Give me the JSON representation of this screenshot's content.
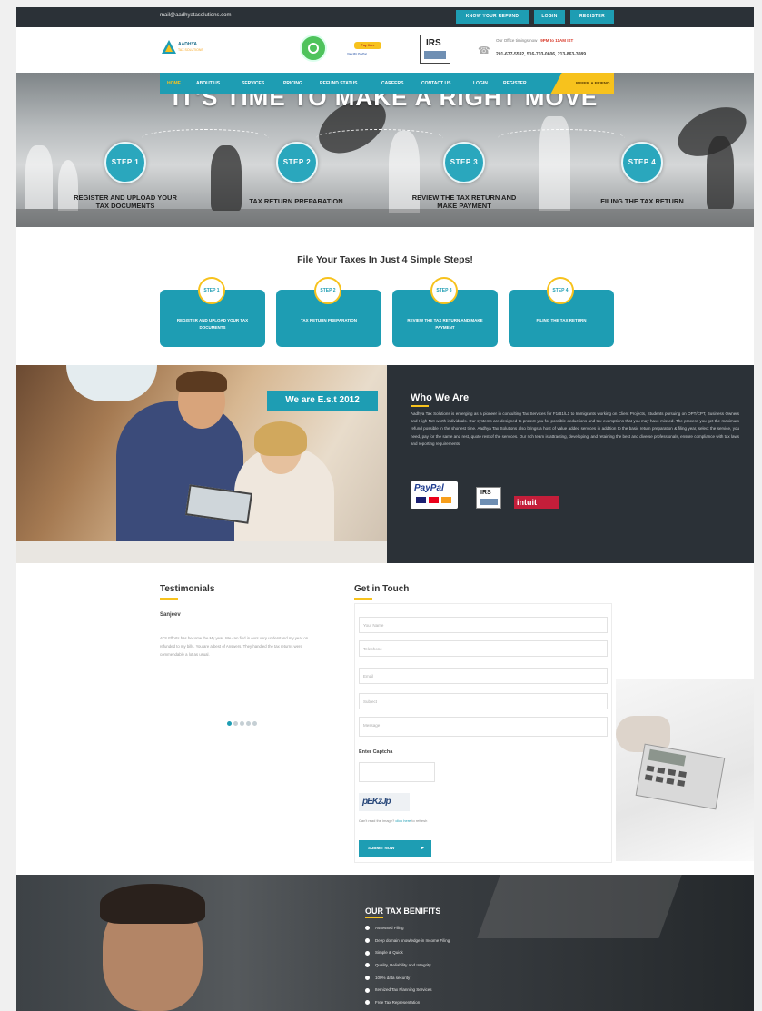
{
  "topbar": {
    "email": "mail@aadhyatasolutions.com",
    "buttons": [
      "KNOW YOUR REFUND",
      "LOGIN",
      "REGISTER"
    ]
  },
  "header": {
    "logo_text": "AADHYA",
    "logo_sub": "TAX SOLUTIONS",
    "pay_text": "Pay Here",
    "pay_sub": "Visa MC PayPal",
    "irs_text": "IRS",
    "office_label": "Our Office timings now :",
    "office_hours": "9PM to 11AM IST",
    "phones": "201-677-5592, 516-703-0606, 213-863-3089"
  },
  "nav": {
    "items": [
      "HOME",
      "ABOUT US",
      "SERVICES",
      "PRICING",
      "REFUND STATUS",
      "CAREERS",
      "CONTACT US",
      "LOGIN",
      "REGISTER"
    ],
    "active": "HOME",
    "cta": "REFER A FRIEND"
  },
  "hero": {
    "headline": "IT'S TIME TO MAKE A RIGHT MOVE",
    "steps": [
      {
        "badge": "STEP 1",
        "caption": "REGISTER AND UPLOAD YOUR TAX DOCUMENTS"
      },
      {
        "badge": "STEP 2",
        "caption": "TAX RETURN PREPARATION"
      },
      {
        "badge": "STEP 3",
        "caption": "REVIEW THE TAX RETURN AND MAKE PAYMENT"
      },
      {
        "badge": "STEP 4",
        "caption": "FILING THE TAX RETURN"
      }
    ]
  },
  "steps_section": {
    "title": "File Your Taxes In Just 4 Simple Steps!",
    "steps": [
      {
        "badge": "STEP 1",
        "label": "REGISTER AND UPLOAD YOUR TAX DOCUMENTS"
      },
      {
        "badge": "STEP 2",
        "label": "TAX RETURN PREPARATION"
      },
      {
        "badge": "STEP 3",
        "label": "REVIEW THE TAX RETURN AND MAKE PAYMENT"
      },
      {
        "badge": "STEP 4",
        "label": "FILING THE TAX RETURN"
      }
    ]
  },
  "who": {
    "badge": "We are E.s.t 2012",
    "title": "Who We Are",
    "text": "Aadhya Tax Solutions is emerging as a pioneer in consulting Tax Services for F1/B1/L1 to Immigrants working on Client Projects, Students pursuing on OPT/CPT, Business Owners and High Net worth individuals. Our systems are designed to protect you for possible deductions and tax exemptions that you may have missed. The process you get the maximum refund possible in the shortest time. Aadhya Tax Solutions also brings a host of value added services in addition to the basic return preparation & filing year, select the service, you need, pay for the same and rest, quote rest of the services. Our rich team is attracting, developing, and retaining the best and diverse professionals, ensure compliance with tax laws and reporting requirements.",
    "logos": {
      "paypal": "PayPal",
      "irs": "IRS",
      "intuit": "intuit"
    }
  },
  "testimonials": {
    "title": "Testimonials",
    "name": "Sanjeev",
    "quote": "ATS Efforts has become the My year. We can find in ours very understand my year on refunded to my bills. You are a best of Answers. They handled the tax returns were commendable a lot as usual."
  },
  "contact": {
    "title": "Get in Touch",
    "placeholders": [
      "Your Name",
      "Telephone",
      "Email",
      "Subject",
      "Message"
    ],
    "captcha_label": "Enter Captcha",
    "captcha_text": "pEKzJp",
    "captcha_help_prefix": "Can't read the image?",
    "captcha_help_link": "click here",
    "captcha_help_suffix": "to refresh",
    "submit": "SUBMIT NOW"
  },
  "benefits": {
    "title": "OUR TAX BENIFITS",
    "items": [
      "Assessed Filing",
      "Deep domain knowledge in Income Filing",
      "Simple & Quick",
      "Quality, Reliability and Integrity",
      "100% data security",
      "Itemized Tax Planning Services",
      "Free Tax Representation"
    ]
  },
  "colors": {
    "teal": "#1e9db3",
    "yellow": "#f7c21d",
    "dark": "#2b3137"
  }
}
